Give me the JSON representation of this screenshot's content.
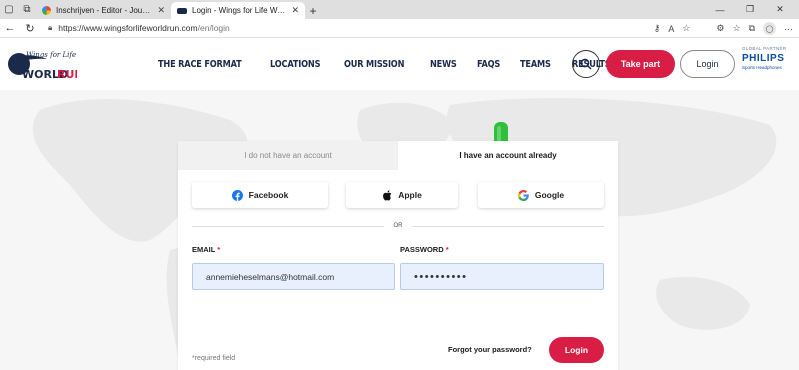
{
  "browser": {
    "tabs": [
      {
        "title": "Inschrijven - Editor - JouwWeb",
        "active": false
      },
      {
        "title": "Login - Wings for Life World Run",
        "active": true
      }
    ],
    "url_domain": "https://www.wingsforlifeworldrun.com",
    "url_path": "/en/login"
  },
  "header": {
    "logo_text_top": "Wings for Life",
    "logo_text_main_a": "WORLD",
    "logo_text_main_b": "RUN",
    "nav": [
      "THE RACE FORMAT",
      "LOCATIONS",
      "OUR MISSION",
      "NEWS",
      "FAQS",
      "TEAMS",
      "RESULTS"
    ],
    "take_part_label": "Take part",
    "login_label": "Login",
    "partner_label": "GLOBAL PARTNER",
    "partner_brand": "PHILIPS",
    "partner_sub": "Sports Headphones"
  },
  "login_card": {
    "tab_no_account": "I do not have an account",
    "tab_have_account": "I have an account already",
    "social": {
      "facebook": "Facebook",
      "apple": "Apple",
      "google": "Google"
    },
    "or_label": "OR",
    "email_label": "EMAIL",
    "password_label": "PASSWORD",
    "required_star": "*",
    "email_value": "annemieheselmans@hotmail.com",
    "password_value": "••••••••••",
    "required_note": "*required field",
    "forgot_label": "Forgot your password?",
    "login_button": "Login"
  },
  "colors": {
    "brand_red": "#d81e45",
    "navy": "#1b2a4a",
    "arrow_green": "#2fbf3a"
  }
}
